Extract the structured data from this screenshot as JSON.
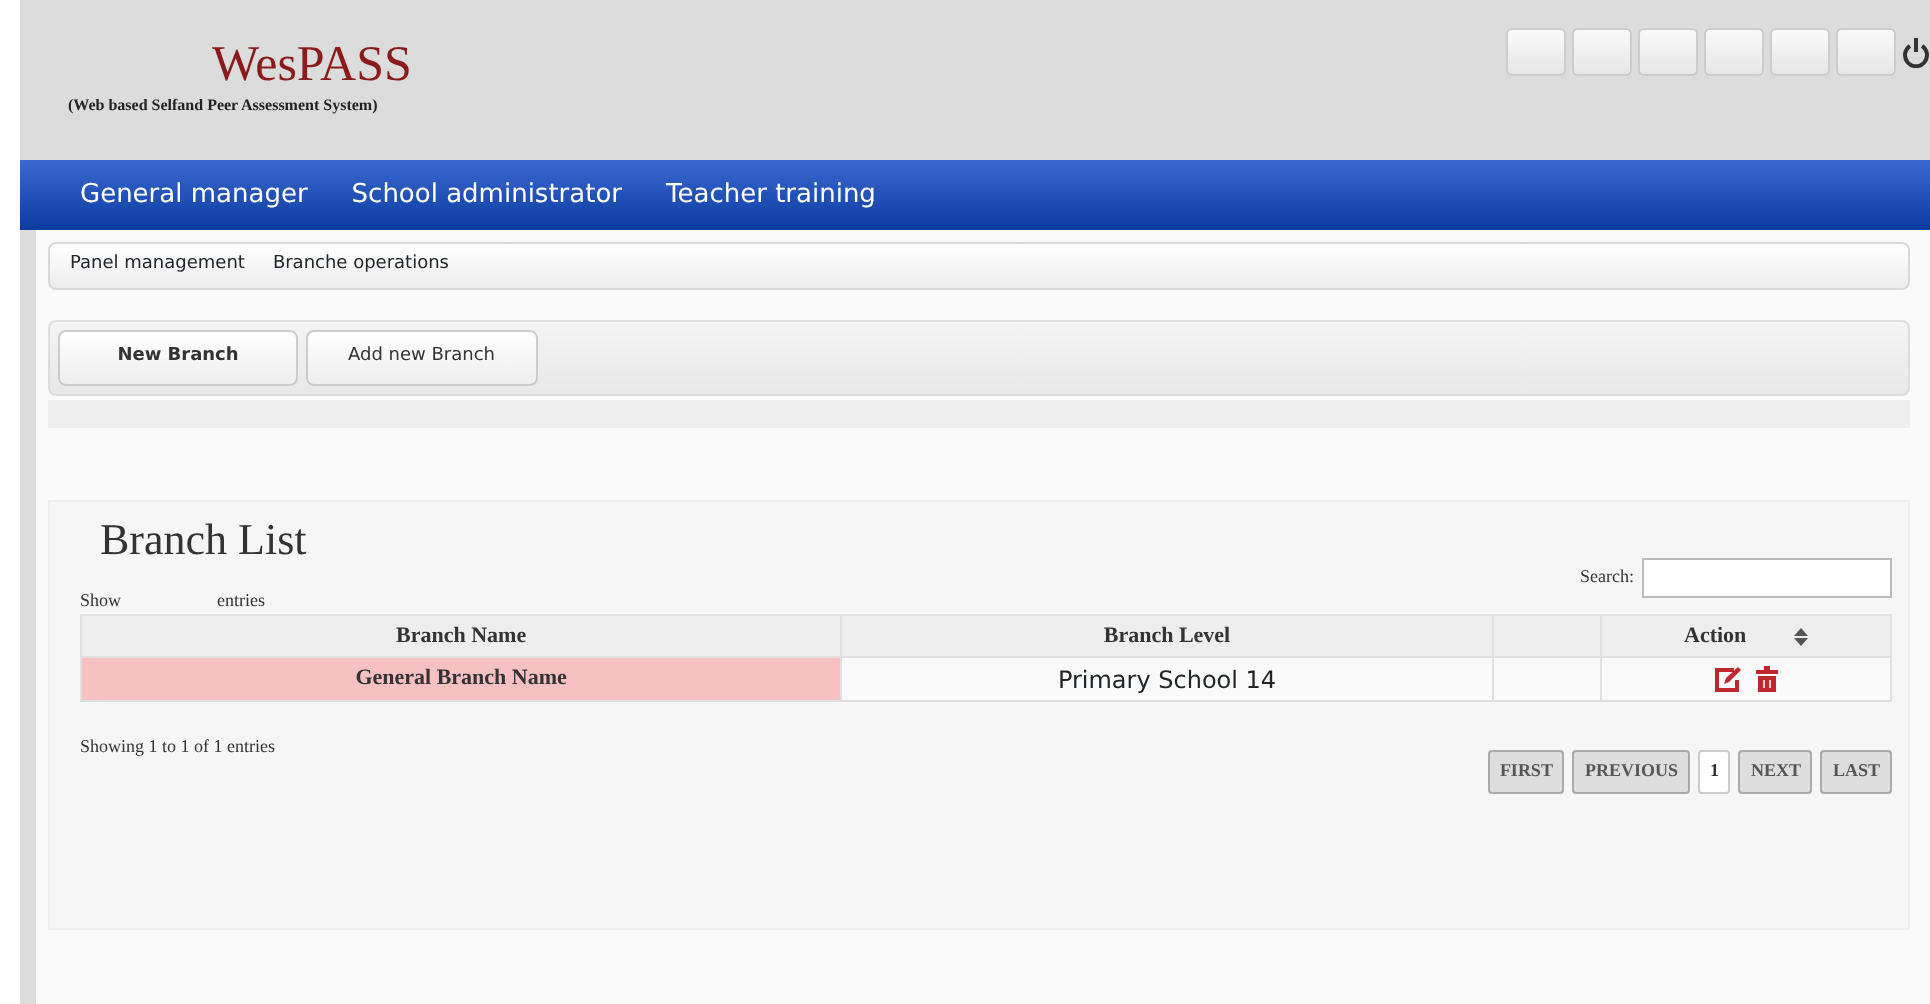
{
  "header": {
    "logo_title": "WesPASS",
    "logo_subtitle": "(Web based Selfand Peer Assessment System)",
    "toolbar_buttons": [
      {
        "kind": "blank"
      },
      {
        "kind": "blank"
      },
      {
        "kind": "blank"
      },
      {
        "kind": "blank"
      },
      {
        "kind": "blank"
      },
      {
        "kind": "blank"
      },
      {
        "kind": "power"
      }
    ]
  },
  "nav": [
    {
      "label": "General manager"
    },
    {
      "label": "School administrator"
    },
    {
      "label": "Teacher training"
    }
  ],
  "breadcrumb": [
    {
      "label": "Panel management"
    },
    {
      "label": "Branche operations"
    }
  ],
  "actions": [
    {
      "label": "New Branch",
      "selected": true
    },
    {
      "label": "Add new Branch",
      "selected": false
    }
  ],
  "list": {
    "title": "Branch List",
    "show_label": "Show",
    "entries_label": "entries",
    "search_label": "Search:",
    "columns": [
      "Branch Name",
      "Branch Level",
      "",
      "Action"
    ],
    "rows": [
      {
        "name": "General Branch Name",
        "level": "Primary School 14",
        "selected": true
      }
    ],
    "info": "Showing 1 to 1 of 1 entries",
    "pages": [
      {
        "label": "FIRST",
        "selected": false
      },
      {
        "label": "PREVIOUS",
        "selected": false
      },
      {
        "label": "1",
        "selected": true
      },
      {
        "label": "NEXT",
        "selected": false
      },
      {
        "label": "LAST",
        "selected": false
      }
    ]
  }
}
